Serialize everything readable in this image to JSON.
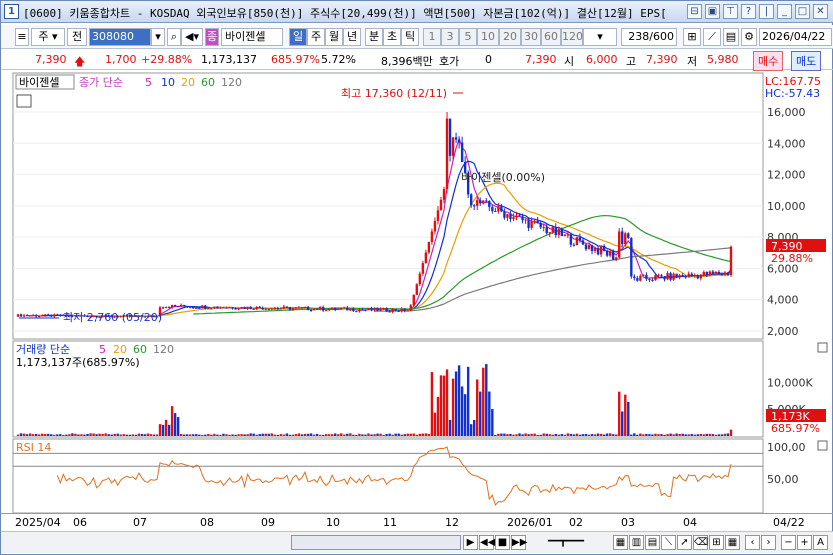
{
  "title": {
    "num": "1",
    "text": "[0600] 키움종합차트 - KOSDAQ 외국인보유[850(천)] 주식수[20,499(천)] 액면[500] 자본금[102(억)] 결산[12월] EPS["
  },
  "toolbar": {
    "type": "주",
    "mode": "전",
    "code": "308080",
    "name": "바이젠셀",
    "periods": [
      "일",
      "주",
      "월",
      "년",
      "분",
      "초",
      "틱"
    ],
    "selected_period": "일",
    "intervals": [
      "1",
      "3",
      "5",
      "10",
      "20",
      "30",
      "60",
      "120"
    ],
    "count": "238",
    "total": "/600",
    "date": "2026/04/22",
    "buy_label": "매수",
    "sell_label": "매도"
  },
  "quote": {
    "price": "7,390",
    "change": "1,700",
    "change_pct": "+29.88%",
    "volume": "1,173,137",
    "volume_pct": "685.97%",
    "turnover": "5.72%",
    "amount": "8,396백만",
    "bid_label": "호가",
    "bid_value": "0",
    "bid_price": "7,390",
    "open_label": "시",
    "open": "6,000",
    "high_label": "고",
    "high": "7,390",
    "low_label": "저",
    "low": "5,980"
  },
  "price_panel": {
    "name_tag": "바이젠셀",
    "ma_label": "종가 단순",
    "ma_periods": [
      "5",
      "10",
      "20",
      "60",
      "120"
    ],
    "lc": "LC:167.75",
    "hc": "HC:-57.43",
    "max_label": "최고 17,360 (12/11)",
    "min_label": "최저 2,760 (05/20)",
    "mid_label": "바이젠셀(0.00%)",
    "current_price_tag": "7,390",
    "current_pct_tag": "29.88%",
    "y_ticks": [
      "16,000",
      "14,000",
      "12,000",
      "10,000",
      "8,000",
      "6,000",
      "4,000",
      "2,000"
    ]
  },
  "volume_panel": {
    "label": "거래량 단순",
    "ma_periods": [
      "5",
      "20",
      "60",
      "120"
    ],
    "value_label": "1,173,137주(685.97%)",
    "y_ticks": [
      "10,000K",
      "5,000K"
    ],
    "current_tag": "1,173K",
    "current_pct_tag": "685.97%"
  },
  "rsi_panel": {
    "label": "RSI 14",
    "y_ticks": [
      "100,00",
      "50,00"
    ]
  },
  "x_axis": [
    "2025/04",
    "06",
    "07",
    "08",
    "09",
    "10",
    "11",
    "12",
    "2026/01",
    "02",
    "03",
    "04"
  ],
  "x_axis_current": "04/22",
  "colors": {
    "up": "#e01010",
    "down": "#1030d0",
    "ma5": "#d020c0",
    "ma10": "#1030d0",
    "ma20": "#e8a000",
    "ma60": "#2a9a2a",
    "ma120": "#7a7a7a",
    "rsi": "#e07020"
  }
}
